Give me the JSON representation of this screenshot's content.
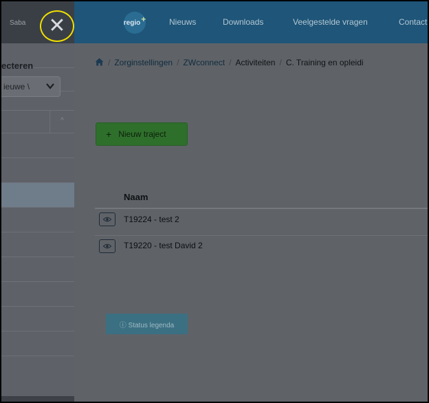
{
  "sidebar": {
    "user_name": "Saba",
    "close_glyph": "✕",
    "filter_label": "ecteren",
    "select_value": "ieuwe \\",
    "sort_glyph": "^"
  },
  "navbar": {
    "logo_text": "regio",
    "logo_plus": "+",
    "items": [
      "Nieuws",
      "Downloads",
      "Veelgestelde vragen",
      "Contact"
    ]
  },
  "breadcrumb": {
    "links": [
      "Zorginstellingen",
      "ZWconnect"
    ],
    "plain": "Activiteiten",
    "current": "C. Training en opleidi",
    "separator": "/"
  },
  "actions": {
    "new_traject_plus": "+",
    "new_traject_label": "Nieuw traject",
    "status_legend_label": "ⓘ Status legenda"
  },
  "table": {
    "header_name": "Naam",
    "rows": [
      "T19224 - test 2",
      "T19220 - test David 2"
    ]
  }
}
